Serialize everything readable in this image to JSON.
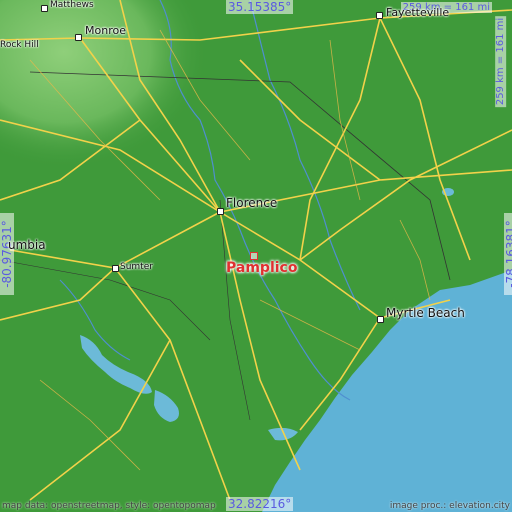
{
  "map": {
    "place": "Pamplico",
    "coords": {
      "top": "35.15385°",
      "bottom": "32.82216°",
      "left": "-80.97631°",
      "right": "-78.16381°"
    },
    "scale": {
      "horizontal": "259 km = 161 mi",
      "vertical": "259 km = 161 mi"
    },
    "cities": [
      {
        "key": "matthews",
        "name": "Matthews"
      },
      {
        "key": "monroe",
        "name": "Monroe"
      },
      {
        "key": "rock_hill",
        "name": "Rock Hill"
      },
      {
        "key": "fayetteville",
        "name": "Fayetteville"
      },
      {
        "key": "florence",
        "name": "Florence"
      },
      {
        "key": "columbia",
        "name": "umbia"
      },
      {
        "key": "sumter",
        "name": "Sumter"
      },
      {
        "key": "myrtle_beach",
        "name": "Myrtle Beach"
      }
    ],
    "credits": {
      "left": "map data: openstreetmap, style: opentopomap",
      "right": "image proc.: elevation.city"
    },
    "colors": {
      "land": "#3f9a3a",
      "upland": "#7cc46a",
      "ocean": "#5fb2d6",
      "road": "#f2d24a",
      "target": "#e03030",
      "coord_text": "#5a5ae0"
    }
  }
}
